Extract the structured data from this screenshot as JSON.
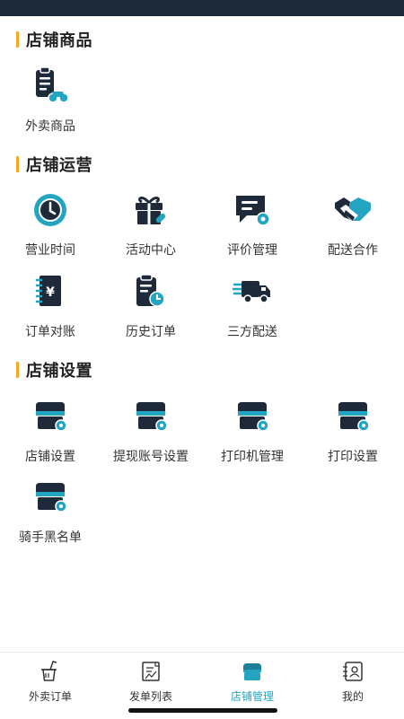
{
  "colors": {
    "accent": "#23a5c2",
    "dark": "#1e2a3a",
    "section_marker": "#f5a623"
  },
  "sections": [
    {
      "title": "店铺商品",
      "items": [
        {
          "label": "外卖商品",
          "icon": "takeout-goods-icon"
        }
      ]
    },
    {
      "title": "店铺运营",
      "items": [
        {
          "label": "营业时间",
          "icon": "clock-icon"
        },
        {
          "label": "活动中心",
          "icon": "gift-icon"
        },
        {
          "label": "评价管理",
          "icon": "review-icon"
        },
        {
          "label": "配送合作",
          "icon": "handshake-icon"
        },
        {
          "label": "订单对账",
          "icon": "order-reconcile-icon"
        },
        {
          "label": "历史订单",
          "icon": "history-order-icon"
        },
        {
          "label": "三方配送",
          "icon": "delivery-truck-icon"
        }
      ]
    },
    {
      "title": "店铺设置",
      "items": [
        {
          "label": "店铺设置",
          "icon": "store-settings-icon"
        },
        {
          "label": "提现账号设置",
          "icon": "store-settings-icon"
        },
        {
          "label": "打印机管理",
          "icon": "store-settings-icon"
        },
        {
          "label": "打印设置",
          "icon": "store-settings-icon"
        },
        {
          "label": "骑手黑名单",
          "icon": "store-settings-icon"
        }
      ]
    }
  ],
  "tabbar": [
    {
      "label": "外卖订单",
      "icon": "takeout-order-icon",
      "active": false
    },
    {
      "label": "发单列表",
      "icon": "dispatch-list-icon",
      "active": false
    },
    {
      "label": "店铺管理",
      "icon": "store-icon",
      "active": true
    },
    {
      "label": "我的",
      "icon": "profile-icon",
      "active": false
    }
  ]
}
